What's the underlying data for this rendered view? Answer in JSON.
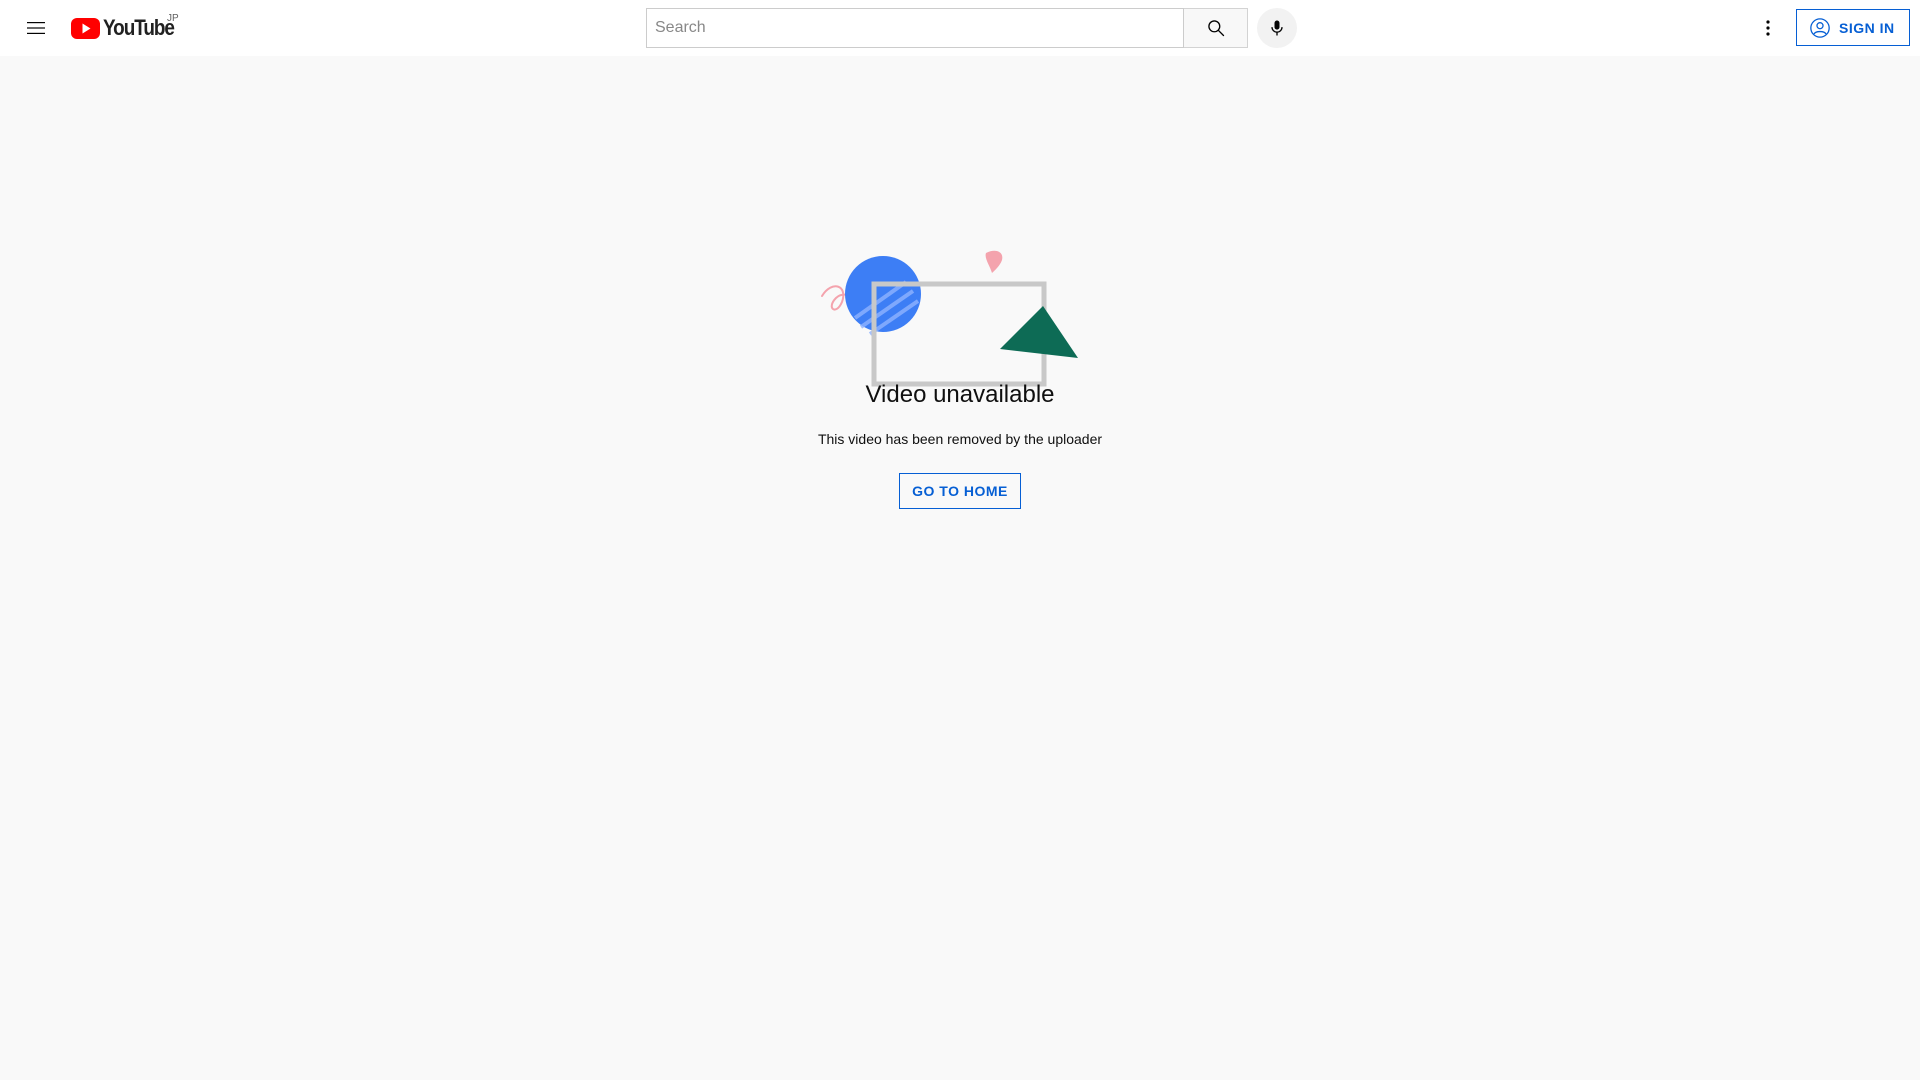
{
  "header": {
    "menu_icon": "hamburger-menu-icon",
    "logo_icon": "youtube-play-icon",
    "logo_text": "YouTube",
    "country_code": "JP",
    "search": {
      "placeholder": "Search",
      "value": ""
    },
    "search_icon": "search-icon",
    "mic_icon": "microphone-icon",
    "more_icon": "more-vertical-icon",
    "signin_icon": "account-circle-icon",
    "signin_label": "SIGN IN"
  },
  "main": {
    "illustration": "video-unavailable-illustration",
    "title": "Video unavailable",
    "message": "This video has been removed by the uploader",
    "home_button_label": "GO TO HOME"
  },
  "colors": {
    "brand_red": "#ff0000",
    "link_blue": "#065fd4",
    "background": "#f9f9f9",
    "masthead": "#ffffff",
    "illustration_blue": "#3d7ef5",
    "illustration_green": "#0d6b55",
    "illustration_pink": "#f4a3ad",
    "illustration_frame": "#c8c8c8"
  }
}
